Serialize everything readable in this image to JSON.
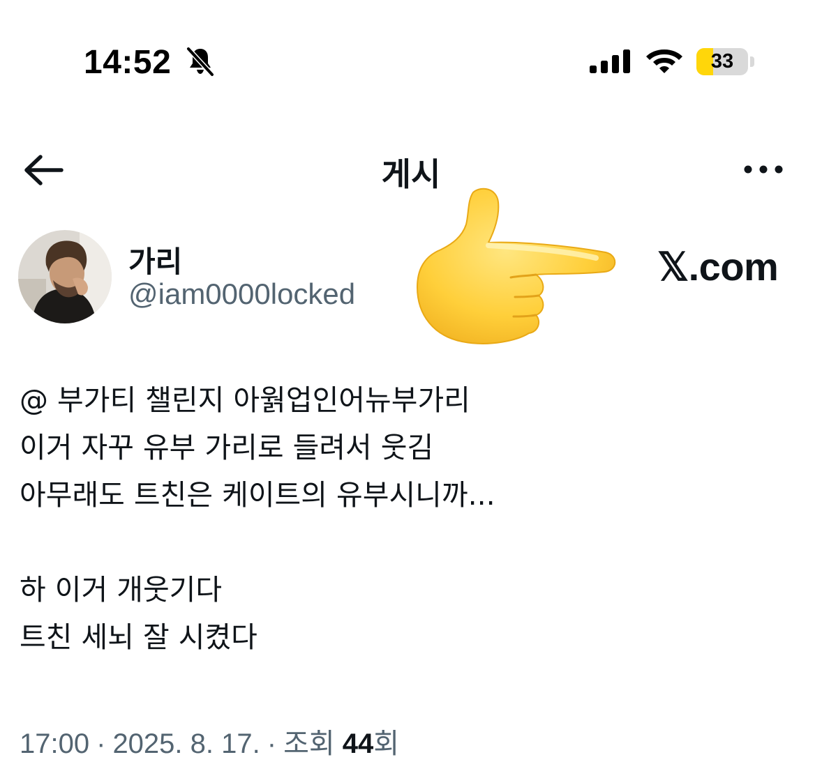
{
  "status_bar": {
    "time": "14:52",
    "battery_level": "33",
    "battery_fraction": 0.33,
    "icons": [
      "bell-slash-icon",
      "cellular-signal-icon",
      "wifi-icon",
      "battery-icon"
    ]
  },
  "header": {
    "title": "게시",
    "back_icon": "arrow-left-icon",
    "more_icon": "more-horizontal-icon"
  },
  "author": {
    "display_name": "가리",
    "handle": "@iam0000locked"
  },
  "overlay": {
    "emoji": "backhand-index-pointing-right",
    "watermark": "𝕏.com"
  },
  "post": {
    "lines": [
      "@ 부가티 챌린지 아웕업인어뉴부가리",
      "이거 자꾸 유부 가리로 들려서 웃김",
      "아무래도 트친은 케이트의 유부시니까...",
      "",
      "하 이거 개웃기다",
      "트친 세뇌 잘 시켰다"
    ]
  },
  "meta": {
    "time": "17:00",
    "date": "2025. 8. 17.",
    "separator": "·",
    "views_label_prefix": "조회",
    "views_count": "44",
    "views_label_suffix": "회"
  },
  "colors": {
    "text_primary": "#0f1419",
    "text_secondary": "#536471",
    "battery_fill": "#ffd60a"
  }
}
